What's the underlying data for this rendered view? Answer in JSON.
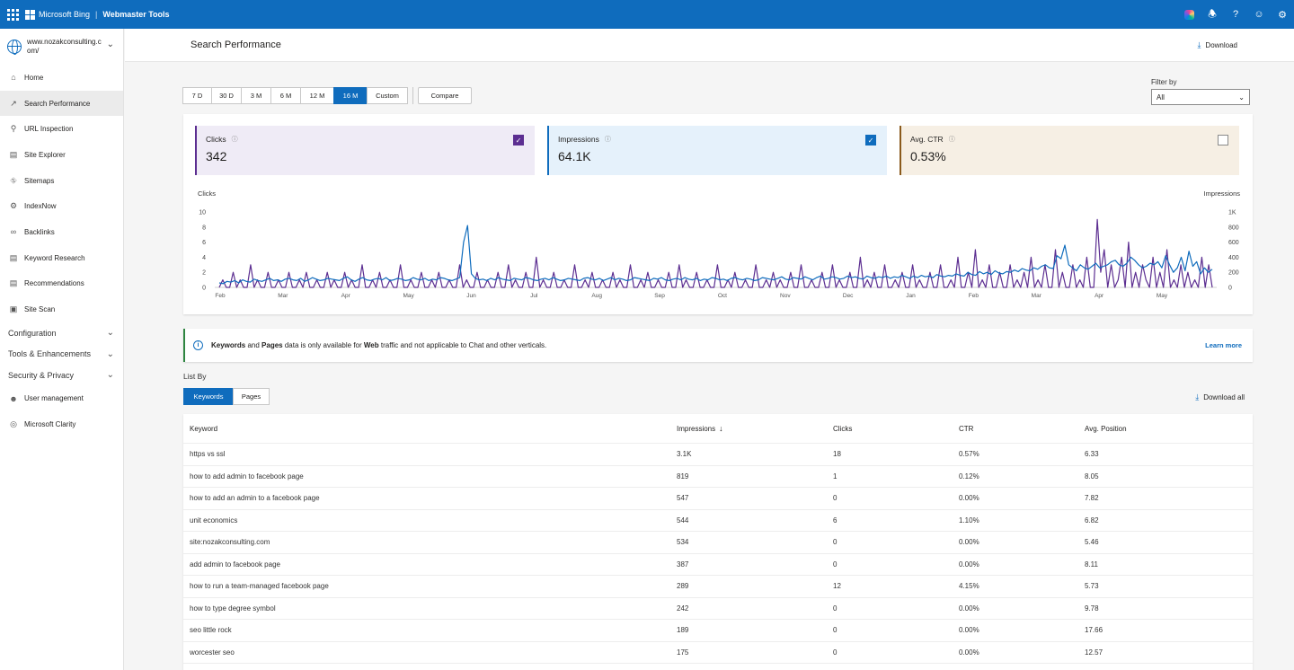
{
  "topbar": {
    "brand": "Microsoft Bing",
    "product": "Webmaster Tools",
    "icons": [
      "apps-icon",
      "copilot-icon",
      "bell-icon",
      "help-icon",
      "feedback-icon",
      "gear-icon"
    ],
    "accent": "#0f6cbd"
  },
  "sidebar": {
    "site": "www.nozakconsulting.com/",
    "items": [
      {
        "label": "Home",
        "icon": "home-icon"
      },
      {
        "label": "Search Performance",
        "icon": "trend-icon"
      },
      {
        "label": "URL Inspection",
        "icon": "search-icon"
      },
      {
        "label": "Site Explorer",
        "icon": "document-icon"
      },
      {
        "label": "Sitemaps",
        "icon": "sitemap-icon"
      },
      {
        "label": "IndexNow",
        "icon": "gear-icon"
      },
      {
        "label": "Backlinks",
        "icon": "link-icon"
      },
      {
        "label": "Keyword Research",
        "icon": "document-icon"
      },
      {
        "label": "Recommendations",
        "icon": "lightbulb-icon"
      },
      {
        "label": "Site Scan",
        "icon": "scan-icon"
      }
    ],
    "groups": [
      "Configuration",
      "Tools & Enhancements",
      "Security & Privacy"
    ],
    "bottom_items": [
      {
        "label": "User management",
        "icon": "user-icon"
      },
      {
        "label": "Microsoft Clarity",
        "icon": "clarity-icon"
      }
    ]
  },
  "header": {
    "title": "Search Performance",
    "download": "Download"
  },
  "ranges": [
    "7 D",
    "30 D",
    "3 M",
    "6 M",
    "12 M",
    "16 M",
    "Custom"
  ],
  "selected_range": "16 M",
  "compare": "Compare",
  "filter": {
    "label": "Filter by",
    "value": "All"
  },
  "metrics": {
    "clicks": {
      "label": "Clicks",
      "value": "342",
      "checked": true,
      "color": "#5c2e91"
    },
    "impressions": {
      "label": "Impressions",
      "value": "64.1K",
      "checked": true,
      "color": "#0f6cbd"
    },
    "ctr": {
      "label": "Avg. CTR",
      "value": "0.53%",
      "checked": false,
      "color": "#8a5a1c"
    }
  },
  "chart_data": {
    "type": "line",
    "left_axis_title": "Clicks",
    "right_axis_title": "Impressions",
    "left_ticks": [
      "10",
      "8",
      "6",
      "4",
      "2",
      "0"
    ],
    "left_ylim": [
      0,
      10
    ],
    "right_ticks": [
      "1K",
      "800",
      "600",
      "400",
      "200",
      "0"
    ],
    "right_ylim": [
      0,
      1000
    ],
    "x_ticks": [
      "Feb",
      "Mar",
      "Apr",
      "May",
      "Jun",
      "Jul",
      "Aug",
      "Sep",
      "Oct",
      "Nov",
      "Dec",
      "Jan",
      "Feb",
      "Mar",
      "Apr",
      "May"
    ],
    "series": [
      {
        "name": "Clicks",
        "axis": "left",
        "color": "#5c2e91",
        "values": [
          0,
          1,
          0,
          0,
          2,
          0,
          1,
          0,
          0,
          3,
          0,
          1,
          0,
          0,
          2,
          0,
          0,
          1,
          0,
          0,
          2,
          0,
          0,
          1,
          0,
          2,
          0,
          0,
          1,
          0,
          0,
          2,
          0,
          1,
          0,
          0,
          2,
          0,
          1,
          0,
          0,
          3,
          0,
          0,
          1,
          0,
          2,
          0,
          0,
          1,
          0,
          0,
          3,
          0,
          0,
          1,
          0,
          0,
          2,
          0,
          0,
          1,
          0,
          2,
          0,
          0,
          1,
          0,
          0,
          3,
          0,
          1,
          0,
          0,
          2,
          0,
          0,
          1,
          0,
          0,
          2,
          0,
          0,
          3,
          0,
          1,
          0,
          0,
          2,
          0,
          0,
          4,
          0,
          1,
          0,
          0,
          2,
          0,
          0,
          1,
          0,
          0,
          3,
          0,
          0,
          1,
          0,
          2,
          0,
          0,
          1,
          0,
          0,
          2,
          0,
          1,
          0,
          0,
          3,
          0,
          0,
          1,
          0,
          2,
          0,
          0,
          1,
          0,
          0,
          2,
          0,
          0,
          3,
          0,
          1,
          0,
          0,
          2,
          0,
          0,
          1,
          0,
          0,
          3,
          0,
          0,
          1,
          0,
          2,
          0,
          0,
          1,
          0,
          0,
          3,
          0,
          0,
          1,
          0,
          2,
          0,
          1,
          0,
          0,
          2,
          0,
          0,
          3,
          0,
          0,
          1,
          0,
          0,
          2,
          0,
          0,
          3,
          0,
          1,
          0,
          0,
          2,
          0,
          0,
          4,
          0,
          1,
          0,
          2,
          0,
          0,
          3,
          0,
          0,
          1,
          0,
          2,
          0,
          0,
          3,
          0,
          1,
          0,
          0,
          2,
          0,
          0,
          3,
          0,
          0,
          1,
          0,
          4,
          0,
          0,
          2,
          0,
          5,
          0,
          1,
          0,
          3,
          0,
          0,
          2,
          0,
          0,
          3,
          0,
          1,
          0,
          2,
          0,
          4,
          0,
          1,
          0,
          3,
          0,
          0,
          5,
          0,
          2,
          0,
          0,
          3,
          0,
          1,
          0,
          4,
          0,
          0,
          9,
          2,
          5,
          0,
          3,
          0,
          1,
          4,
          0,
          6,
          0,
          2,
          0,
          3,
          1,
          0,
          4,
          0,
          2,
          0,
          5,
          0,
          1,
          0,
          3,
          0,
          2,
          0,
          1,
          0,
          4,
          0,
          3,
          0
        ]
      },
      {
        "name": "Impressions",
        "axis": "right",
        "color": "#0f6cbd",
        "values": [
          60,
          50,
          80,
          70,
          90,
          60,
          100,
          80,
          70,
          110,
          90,
          80,
          100,
          120,
          90,
          100,
          80,
          110,
          120,
          100,
          90,
          120,
          80,
          100,
          130,
          110,
          90,
          100,
          120,
          110,
          100,
          90,
          120,
          140,
          100,
          80,
          110,
          130,
          100,
          90,
          110,
          120,
          100,
          130,
          90,
          100,
          120,
          110,
          90,
          100,
          130,
          110,
          100,
          120,
          90,
          110,
          100,
          130,
          120,
          100,
          90,
          110,
          130,
          600,
          820,
          180,
          120,
          100,
          110,
          90,
          120,
          100,
          130,
          110,
          100,
          90,
          120,
          110,
          100,
          130,
          120,
          100,
          90,
          110,
          120,
          100,
          130,
          110,
          90,
          100,
          120,
          110,
          100,
          90,
          120,
          130,
          110,
          100,
          120,
          90,
          110,
          130,
          100,
          120,
          110,
          90,
          100,
          130,
          120,
          110,
          100,
          90,
          120,
          110,
          130,
          100,
          90,
          110,
          120,
          100,
          130,
          110,
          100,
          120,
          90,
          110,
          100,
          130,
          120,
          100,
          110,
          90,
          120,
          130,
          110,
          100,
          120,
          110,
          90,
          100,
          130,
          120,
          110,
          100,
          120,
          140,
          110,
          100,
          130,
          120,
          110,
          140,
          120,
          100,
          130,
          150,
          110,
          120,
          140,
          130,
          110,
          120,
          150,
          130,
          140,
          120,
          110,
          150,
          130,
          120,
          140,
          130,
          150,
          120,
          140,
          130,
          160,
          140,
          120,
          150,
          130,
          160,
          140,
          150,
          130,
          170,
          150,
          140,
          160,
          150,
          180,
          160,
          150,
          200,
          170,
          160,
          210,
          180,
          200,
          170,
          220,
          190,
          180,
          210,
          200,
          230,
          210,
          250,
          230,
          220,
          260,
          240,
          280,
          300,
          260,
          250,
          420,
          380,
          560,
          300,
          260,
          220,
          300,
          260,
          240,
          280,
          320,
          260,
          280,
          300,
          340,
          360,
          300,
          280,
          320,
          400,
          360,
          300,
          260,
          280,
          320,
          300,
          340,
          260,
          420,
          300,
          200,
          260,
          400,
          220,
          480,
          280,
          340,
          180,
          260,
          200,
          240
        ]
      }
    ]
  },
  "info_banner": {
    "pre": "",
    "keywords": "Keywords",
    "and": " and ",
    "pages": "Pages",
    "mid": " data is only available for ",
    "web": "Web",
    "post": " traffic and not applicable to Chat and other verticals.",
    "link": "Learn more"
  },
  "list": {
    "title": "List By",
    "tabs": [
      "Keywords",
      "Pages"
    ],
    "download_all": "Download all"
  },
  "table": {
    "headers": [
      "Keyword",
      "Impressions",
      "Clicks",
      "CTR",
      "Avg. Position"
    ],
    "rows": [
      [
        "https vs ssl",
        "3.1K",
        "18",
        "0.57%",
        "6.33"
      ],
      [
        "how to add admin to facebook page",
        "819",
        "1",
        "0.12%",
        "8.05"
      ],
      [
        "how to add an admin to a facebook page",
        "547",
        "0",
        "0.00%",
        "7.82"
      ],
      [
        "unit economics",
        "544",
        "6",
        "1.10%",
        "6.82"
      ],
      [
        "site:nozakconsulting.com",
        "534",
        "0",
        "0.00%",
        "5.46"
      ],
      [
        "add admin to facebook page",
        "387",
        "0",
        "0.00%",
        "8.11"
      ],
      [
        "how to run a team-managed facebook page",
        "289",
        "12",
        "4.15%",
        "5.73"
      ],
      [
        "how to type degree symbol",
        "242",
        "0",
        "0.00%",
        "9.78"
      ],
      [
        "seo little rock",
        "189",
        "0",
        "0.00%",
        "17.66"
      ],
      [
        "worcester seo",
        "175",
        "0",
        "0.00%",
        "12.57"
      ]
    ]
  }
}
